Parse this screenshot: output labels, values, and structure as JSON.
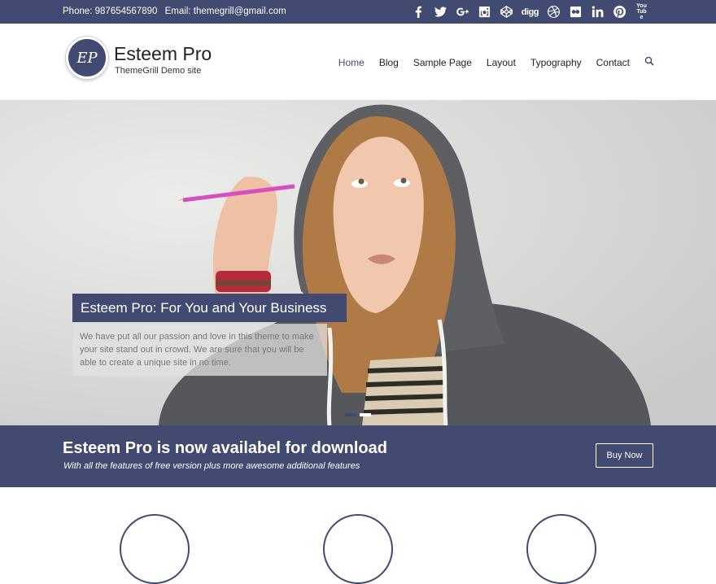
{
  "topbar": {
    "phone": "Phone: 987654567890",
    "email": "Email: themegrill@gmail.com",
    "social": [
      "facebook-icon",
      "twitter-icon",
      "google-plus-icon",
      "instagram-icon",
      "codepen-icon",
      "digg-icon",
      "dribbble-icon",
      "flickr-icon",
      "linkedin-icon",
      "pinterest-icon",
      "youtube-icon"
    ],
    "digg_label": "digg",
    "youtube_label": "You Tube"
  },
  "header": {
    "logo_text": "EP",
    "site_title": "Esteem Pro",
    "site_description": "ThemeGrill Demo site"
  },
  "nav": {
    "items": [
      "Home",
      "Blog",
      "Sample Page",
      "Layout",
      "Typography",
      "Contact"
    ]
  },
  "slider": {
    "title": "Esteem Pro: For You and Your Business",
    "text": "We have put all our passion and love in this theme to make your site stand out in crowd. We are sure that you will be able to create a unique site in no time."
  },
  "cta": {
    "title": "Esteem Pro is now availabel for download",
    "subtitle": "With all the features of free version plus more awesome additional features",
    "button": "Buy Now"
  },
  "colors": {
    "primary": "#434a72"
  }
}
